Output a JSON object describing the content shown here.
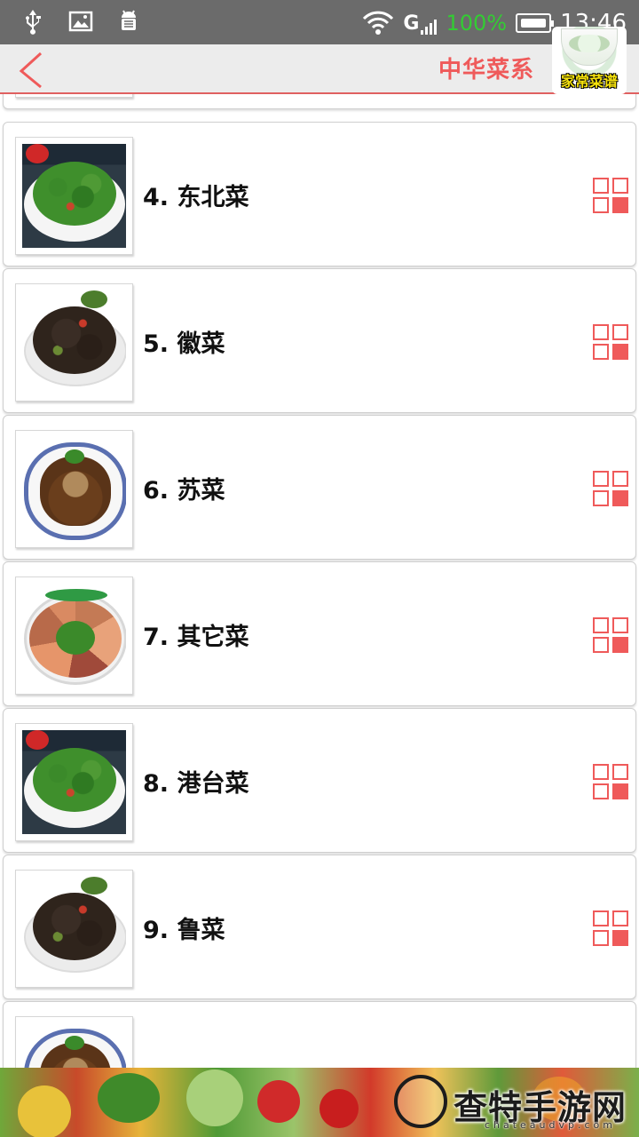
{
  "status_bar": {
    "carrier": "G",
    "battery_percent": "100%",
    "time": "13:46",
    "left_icons": [
      "usb-icon",
      "image-icon",
      "android-debug-icon"
    ]
  },
  "header": {
    "title": "中华菜系",
    "logo_text": "家常菜谱",
    "accent_color": "#ef5a5a"
  },
  "list": {
    "items": [
      {
        "label": "4. 东北菜",
        "thumbnail": "greens"
      },
      {
        "label": "5. 徽菜",
        "thumbnail": "fungus"
      },
      {
        "label": "6. 苏菜",
        "thumbnail": "su"
      },
      {
        "label": "7. 其它菜",
        "thumbnail": "platter"
      },
      {
        "label": "8. 港台菜",
        "thumbnail": "greens"
      },
      {
        "label": "9. 鲁菜",
        "thumbnail": "fungus"
      }
    ]
  },
  "banner": {
    "text": "查特手游网",
    "url": "chateaudvp.com"
  }
}
